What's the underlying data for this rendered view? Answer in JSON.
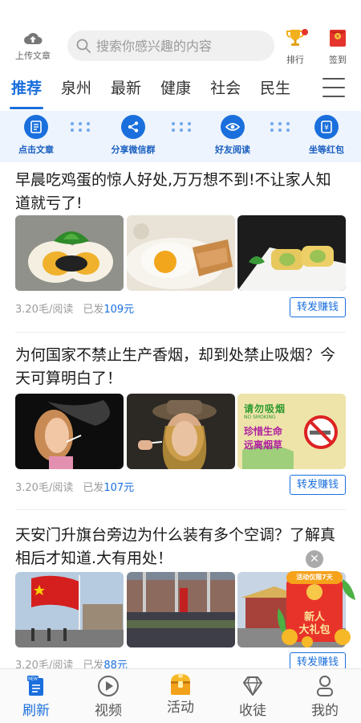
{
  "header": {
    "upload_label": "上传文章",
    "search_placeholder": "搜索你感兴趣的内容",
    "rank_label": "排行",
    "checkin_label": "签到"
  },
  "tabs": [
    "推荐",
    "泉州",
    "最新",
    "健康",
    "社会",
    "民生"
  ],
  "active_tab": "推荐",
  "steps": [
    "点击文章",
    "分享微信群",
    "好友阅读",
    "坐等红包"
  ],
  "articles": [
    {
      "title": "早晨吃鸡蛋的惊人好处,万万想不到!不让家人知道就亏了!",
      "rate": "3.20毛/阅读",
      "sent_prefix": "已发",
      "sent_amount": "109元",
      "button": "转发赚钱"
    },
    {
      "title": "为何国家不禁止生产香烟，却到处禁止吸烟？今天可算明白了！",
      "rate": "3.20毛/阅读",
      "sent_prefix": "已发",
      "sent_amount": "107元",
      "button": "转发赚钱",
      "sign_text": [
        "请勿吸烟",
        "NO SMOKING",
        "珍惜生命",
        "远离烟草"
      ]
    },
    {
      "title": "天安门升旗台旁边为什么装有多个空调？了解真相后才知道.大有用处！",
      "rate": "3.20毛/阅读",
      "sent_prefix": "已发",
      "sent_amount": "88元",
      "button": "转发赚钱"
    }
  ],
  "promo": {
    "top": "活动仅限7天",
    "line1": "新人",
    "line2": "大礼包",
    "close": "✕"
  },
  "bottom_nav": [
    {
      "label": "刷新",
      "icon": "refresh-news-icon",
      "badge": "NEW",
      "active": true
    },
    {
      "label": "视频",
      "icon": "play-video-icon",
      "active": false
    },
    {
      "label": "活动",
      "icon": "treasure-chest-icon",
      "active": false
    },
    {
      "label": "收徒",
      "icon": "diamond-icon",
      "active": false
    },
    {
      "label": "我的",
      "icon": "person-icon",
      "active": false
    }
  ],
  "colors": {
    "accent": "#1a6fdd",
    "step_bg": "#edf4fd",
    "red": "#e4342b",
    "gold": "#f2b01e"
  }
}
